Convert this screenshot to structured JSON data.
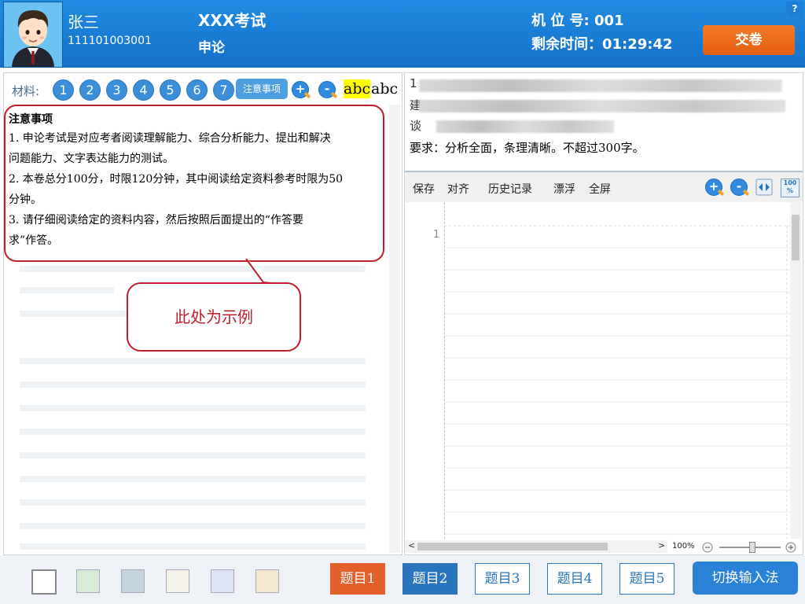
{
  "header": {
    "candidate_name": "张三",
    "ticket_number": "111101003001",
    "exam_title": "XXX考试",
    "exam_subject": "申论",
    "seat_label": "机 位 号:",
    "seat_number": "001",
    "time_label": "剩余时间：",
    "time_remaining": "01:29:42",
    "submit_label": "交卷",
    "help_label": "?"
  },
  "material_toolbar": {
    "label": "材料:",
    "numbers": [
      "1",
      "2",
      "3",
      "4",
      "5",
      "6",
      "7"
    ],
    "notice_button": "注意事项",
    "zoom_in": "+",
    "zoom_out": "-",
    "highlight_sample": "abc",
    "plain_sample": "abc"
  },
  "notice": {
    "title": "注意事项",
    "lines": [
      "1. 申论考试是对应考者阅读理解能力、综合分析能力、提出和解决",
      "问题能力、文字表达能力的测试。",
      "2. 本卷总分100分，时限120分钟，其中阅读给定资料参考时限为50",
      "分钟。",
      "3. 请仔细阅读给定的资料内容，然后按照后面提出的“作答要",
      "求”作答。"
    ],
    "callout_text": "此处为示例"
  },
  "question": {
    "line_starts": [
      "1",
      "建",
      "谈"
    ],
    "requirement": "要求：分析全面，条理清晰。不超过300字。"
  },
  "editor_toolbar": {
    "save": "保存",
    "align": "对齐",
    "history": "历史记录",
    "float": "漂浮",
    "fullscreen": "全屏",
    "percent_icon": "100 %"
  },
  "editor": {
    "line_number": "1",
    "zoom_level": "100%",
    "scroll_left": "<",
    "scroll_right": ">"
  },
  "bottom_bar": {
    "swatches": [
      "#ffffff",
      "#d6ecd6",
      "#c3d4dc",
      "#f4f1ea",
      "#dbe3f5",
      "#f3e8cc"
    ],
    "question_tabs": [
      "题目1",
      "题目2",
      "题目3",
      "题目4",
      "题目5"
    ],
    "switch_ime": "切换输入法"
  },
  "colors": {
    "header_blue": "#1a7dd8",
    "submit_orange": "#ee6a1c",
    "active_tab_orange": "#e3602a",
    "visited_tab_blue": "#2a76be",
    "annotation_red": "#c01f2a"
  }
}
